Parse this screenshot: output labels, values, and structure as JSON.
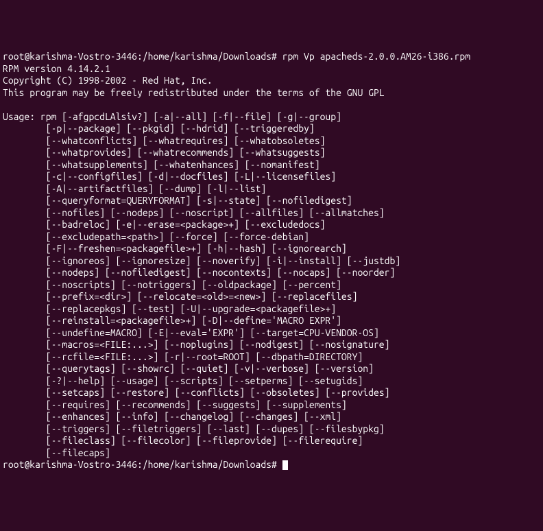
{
  "prompt1": {
    "user_host": "root@karishma-Vostro-3446",
    "path": ":/home/karishma/Downloads#",
    "command": " rpm Vp apacheds-2.0.0.AM26-i386.rpm"
  },
  "version": "RPM version 4.14.2.1",
  "copyright": "Copyright (C) 1998-2002 - Red Hat, Inc.",
  "license": "This program may be freely redistributed under the terms of the GNU GPL",
  "usage_label": "Usage: ",
  "usage_lines": [
    "rpm [-afgpcdLAlsiv?] [-a|--all] [-f|--file] [-g|--group]",
    "[-p|--package] [--pkgid] [--hdrid] [--triggeredby]",
    "[--whatconflicts] [--whatrequires] [--whatobsoletes]",
    "[--whatprovides] [--whatrecommends] [--whatsuggests]",
    "[--whatsupplements] [--whatenhances] [--nomanifest]",
    "[-c|--configfiles] [-d|--docfiles] [-L|--licensefiles]",
    "[-A|--artifactfiles] [--dump] [-l|--list]",
    "[--queryformat=QUERYFORMAT] [-s|--state] [--nofiledigest]",
    "[--nofiles] [--nodeps] [--noscript] [--allfiles] [--allmatches]",
    "[--badreloc] [-e|--erase=<package>+] [--excludedocs]",
    "[--excludepath=<path>] [--force] [--force-debian]",
    "[-F|--freshen=<packagefile>+] [-h|--hash] [--ignorearch]",
    "[--ignoreos] [--ignoresize] [--noverify] [-i|--install] [--justdb]",
    "[--nodeps] [--nofiledigest] [--nocontexts] [--nocaps] [--noorder]",
    "[--noscripts] [--notriggers] [--oldpackage] [--percent]",
    "[--prefix=<dir>] [--relocate=<old>=<new>] [--replacefiles]",
    "[--replacepkgs] [--test] [-U|--upgrade=<packagefile>+]",
    "[--reinstall=<packagefile>+] [-D|--define='MACRO EXPR']",
    "[--undefine=MACRO] [-E|--eval='EXPR'] [--target=CPU-VENDOR-OS]",
    "[--macros=<FILE:...>] [--noplugins] [--nodigest] [--nosignature]",
    "[--rcfile=<FILE:...>] [-r|--root=ROOT] [--dbpath=DIRECTORY]",
    "[--querytags] [--showrc] [--quiet] [-v|--verbose] [--version]",
    "[-?|--help] [--usage] [--scripts] [--setperms] [--setugids]",
    "[--setcaps] [--restore] [--conflicts] [--obsoletes] [--provides]",
    "[--requires] [--recommends] [--suggests] [--supplements]",
    "[--enhances] [--info] [--changelog] [--changes] [--xml]",
    "[--triggers] [--filetriggers] [--last] [--dupes] [--filesbypkg]",
    "[--fileclass] [--filecolor] [--fileprovide] [--filerequire]",
    "[--filecaps]"
  ],
  "prompt2": {
    "user_host": "root@karishma-Vostro-3446",
    "path": ":/home/karishma/Downloads#",
    "command": " "
  }
}
